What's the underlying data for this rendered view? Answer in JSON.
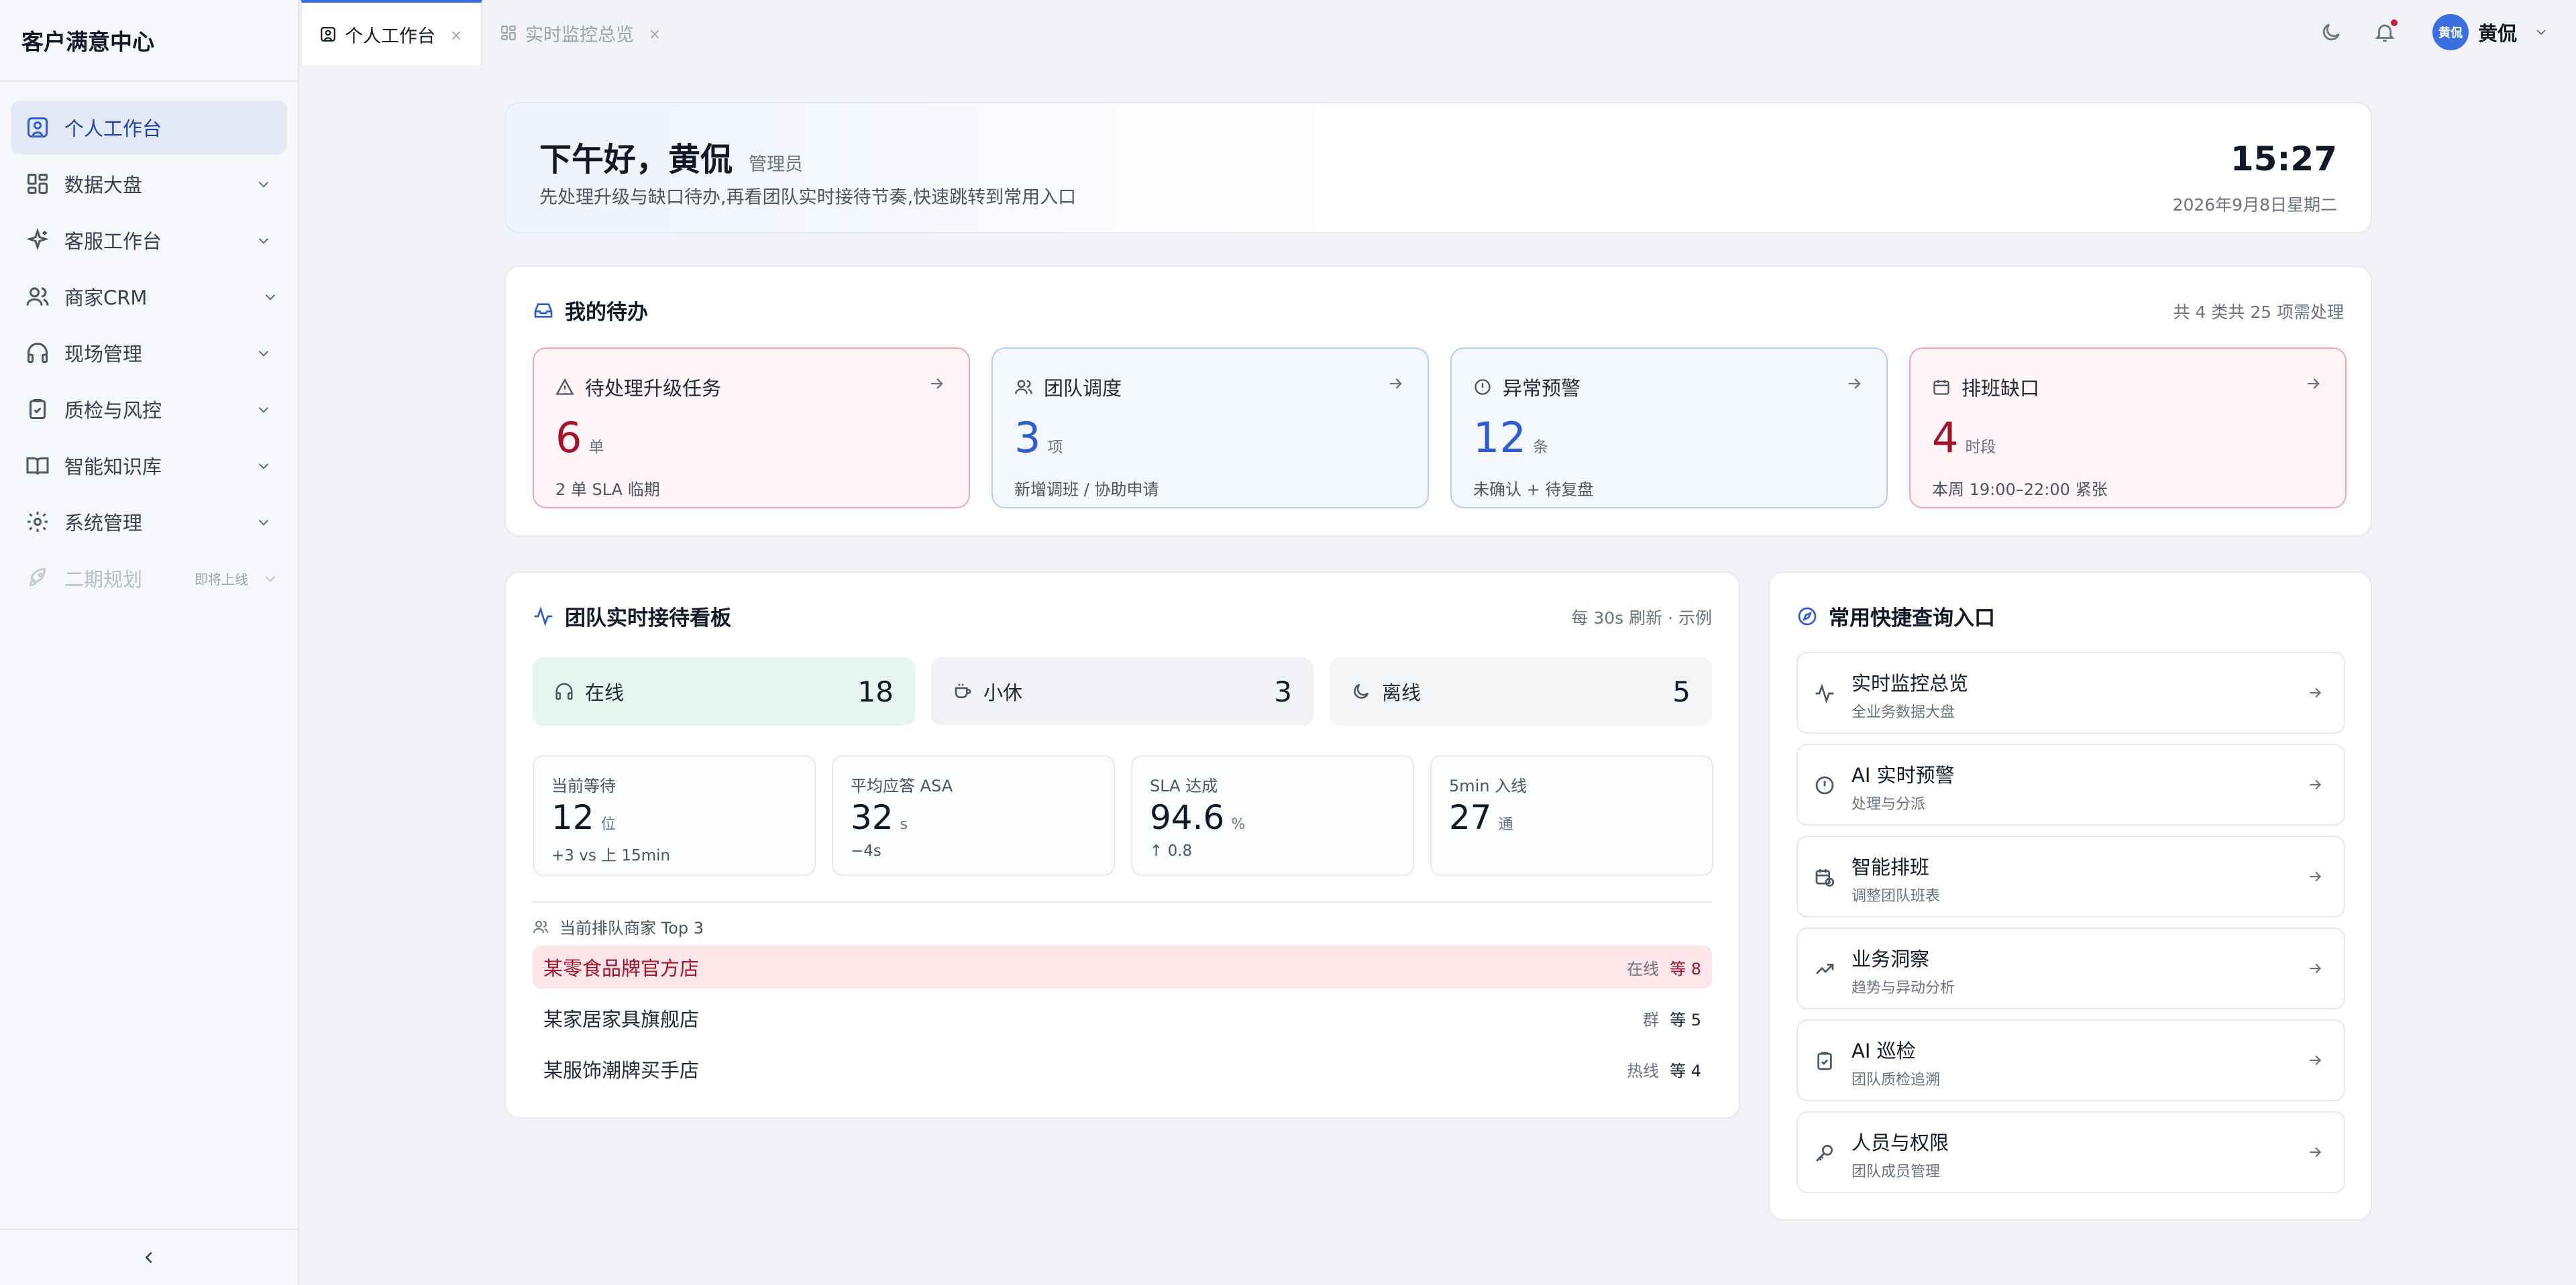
{
  "app": {
    "title": "客户满意中心"
  },
  "sidebar": {
    "items": [
      {
        "label": "个人工作台"
      },
      {
        "label": "数据大盘"
      },
      {
        "label": "客服工作台"
      },
      {
        "label": "商家CRM"
      },
      {
        "label": "现场管理"
      },
      {
        "label": "质检与风控"
      },
      {
        "label": "智能知识库"
      },
      {
        "label": "系统管理"
      },
      {
        "label": "二期规划",
        "badge": "即将上线"
      }
    ]
  },
  "tabs": [
    {
      "label": "个人工作台"
    },
    {
      "label": "实时监控总览"
    }
  ],
  "user": {
    "avatar_text": "黄侃",
    "name": "黄侃"
  },
  "greeting": {
    "title": "下午好，黄侃",
    "role": "管理员",
    "subtitle": "先处理升级与缺口待办,再看团队实时接待节奏,快速跳转到常用入口",
    "time": "15:27",
    "date": "2026年9月8日星期二"
  },
  "todos": {
    "title": "我的待办",
    "summary": "共 4 类共 25 项需处理",
    "items": [
      {
        "label": "待处理升级任务",
        "value": "6",
        "unit": "单",
        "desc": "2 单 SLA 临期"
      },
      {
        "label": "团队调度",
        "value": "3",
        "unit": "项",
        "desc": "新增调班 / 协助申请"
      },
      {
        "label": "异常预警",
        "value": "12",
        "unit": "条",
        "desc": "未确认 + 待复盘"
      },
      {
        "label": "排班缺口",
        "value": "4",
        "unit": "时段",
        "desc": "本周 19:00–22:00 紧张"
      }
    ]
  },
  "board": {
    "title": "团队实时接待看板",
    "meta": "每 30s 刷新 · 示例",
    "status": [
      {
        "label": "在线",
        "count": "18"
      },
      {
        "label": "小休",
        "count": "3"
      },
      {
        "label": "离线",
        "count": "5"
      }
    ],
    "metrics": [
      {
        "label": "当前等待",
        "value": "12",
        "unit": "位",
        "delta": "+3 vs 上 15min"
      },
      {
        "label": "平均应答 ASA",
        "value": "32",
        "unit": "s",
        "delta": "−4s"
      },
      {
        "label": "SLA 达成",
        "value": "94.6",
        "unit": "%",
        "delta": "↑ 0.8"
      },
      {
        "label": "5min 入线",
        "value": "27",
        "unit": "通",
        "delta": ""
      }
    ],
    "queue_title": "当前排队商家 Top 3",
    "queue": [
      {
        "name": "某零食品牌官方店",
        "channel": "在线",
        "wait": "等 8"
      },
      {
        "name": "某家居家具旗舰店",
        "channel": "群",
        "wait": "等 5"
      },
      {
        "name": "某服饰潮牌买手店",
        "channel": "热线",
        "wait": "等 4"
      }
    ]
  },
  "quick": {
    "title": "常用快捷查询入口",
    "items": [
      {
        "name": "实时监控总览",
        "desc": "全业务数据大盘"
      },
      {
        "name": "AI 实时预警",
        "desc": "处理与分派"
      },
      {
        "name": "智能排班",
        "desc": "调整团队班表"
      },
      {
        "name": "业务洞察",
        "desc": "趋势与异动分析"
      },
      {
        "name": "AI 巡检",
        "desc": "团队质检追溯"
      },
      {
        "name": "人员与权限",
        "desc": "团队成员管理"
      }
    ]
  },
  "colors": {
    "accent": "#2f5bd3",
    "danger": "#a31329",
    "online_bg": "#e6f6ee"
  }
}
